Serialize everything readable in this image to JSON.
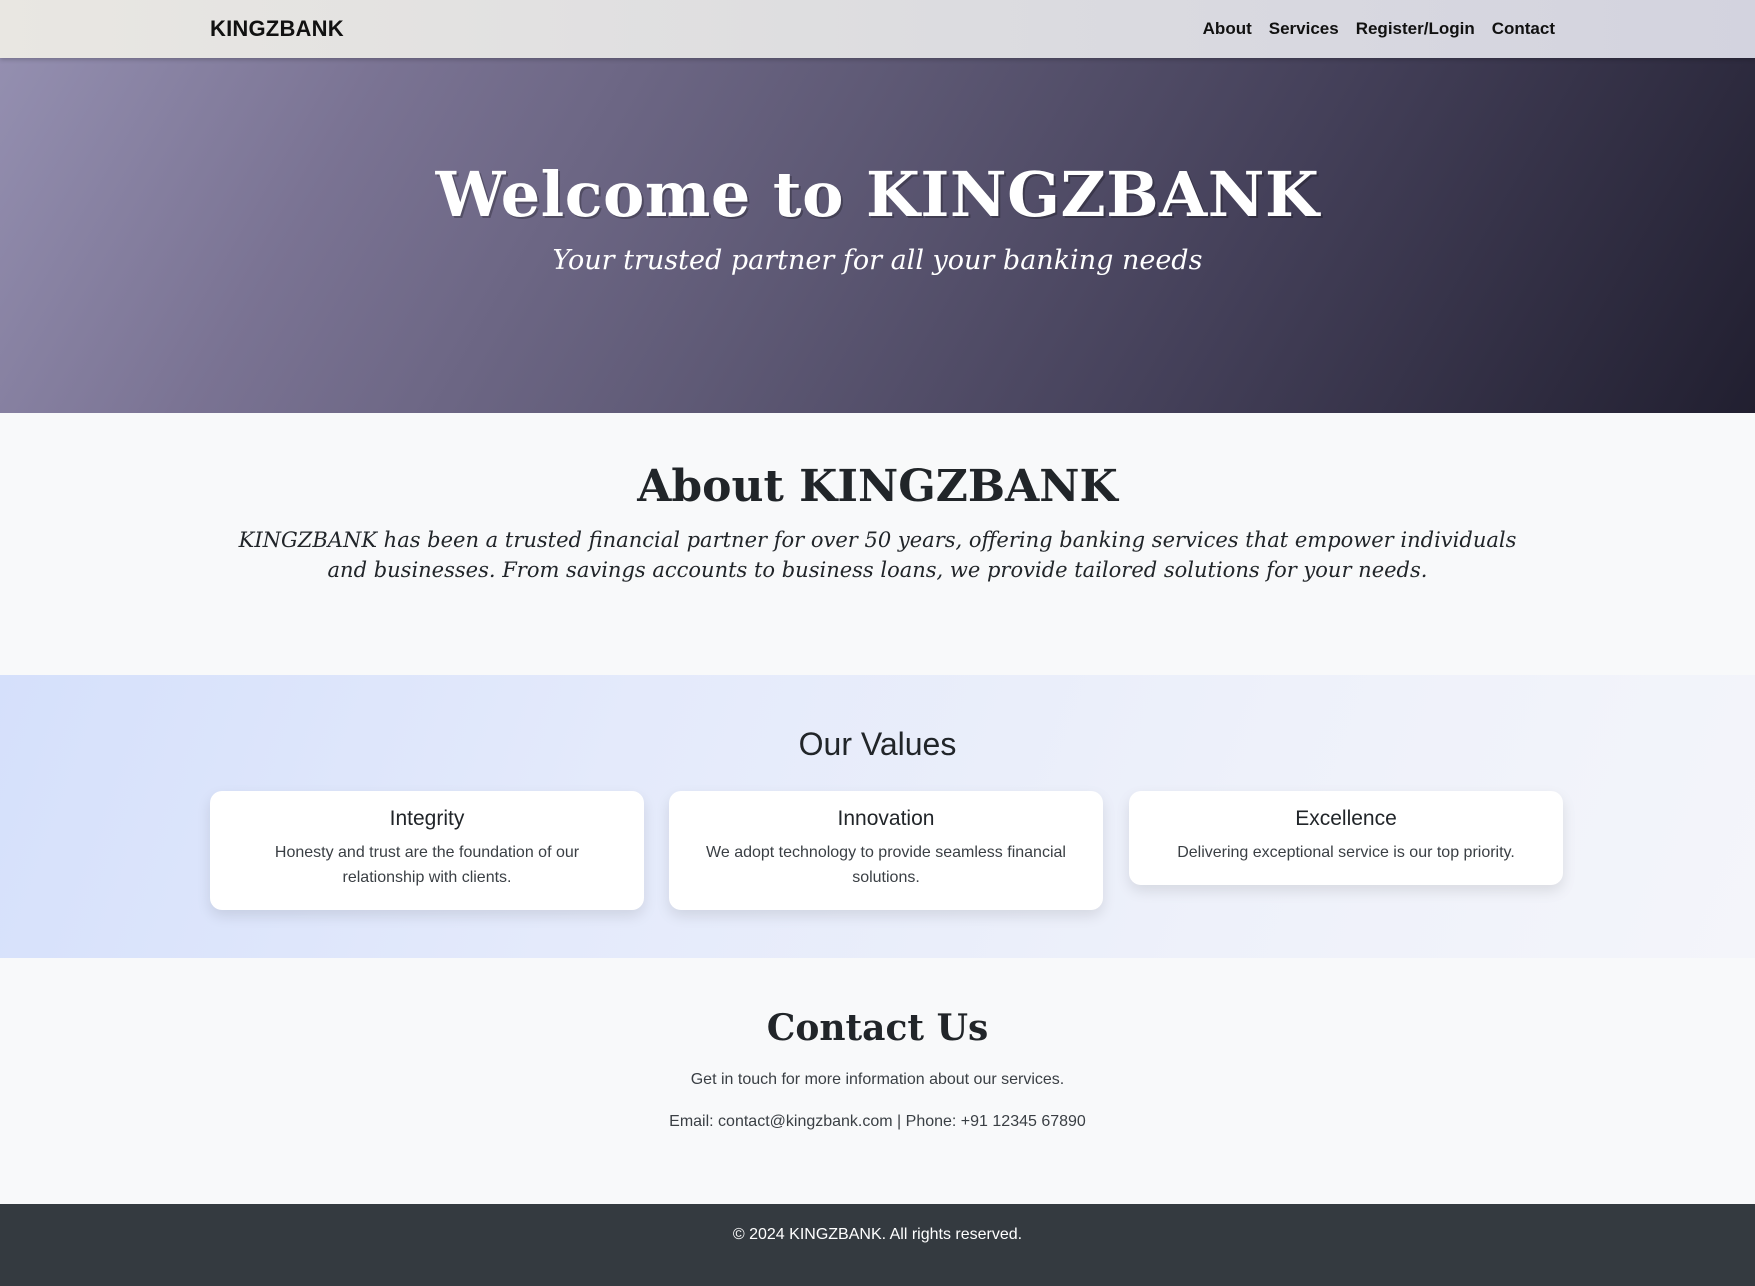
{
  "navbar": {
    "brand": "KINGZBANK",
    "links": [
      "About",
      "Services",
      "Register/Login",
      "Contact"
    ]
  },
  "hero": {
    "title": "Welcome to KINGZBANK",
    "subtitle": "Your trusted partner for all your banking needs"
  },
  "about": {
    "title": "About KINGZBANK",
    "text": "KINGZBANK has been a trusted financial partner for over 50 years, offering banking services that empower individuals and businesses. From savings accounts to business loans, we provide tailored solutions for your needs."
  },
  "values": {
    "title": "Our Values",
    "cards": [
      {
        "title": "Integrity",
        "text": "Honesty and trust are the foundation of our relationship with clients."
      },
      {
        "title": "Innovation",
        "text": "We adopt technology to provide seamless financial solutions."
      },
      {
        "title": "Excellence",
        "text": "Delivering exceptional service is our top priority."
      }
    ]
  },
  "contact": {
    "title": "Contact Us",
    "intro": "Get in touch for more information about our services.",
    "details": "Email: contact@kingzbank.com | Phone: +91 12345 67890"
  },
  "footer": {
    "text": "© 2024 KINGZBANK. All rights reserved."
  }
}
